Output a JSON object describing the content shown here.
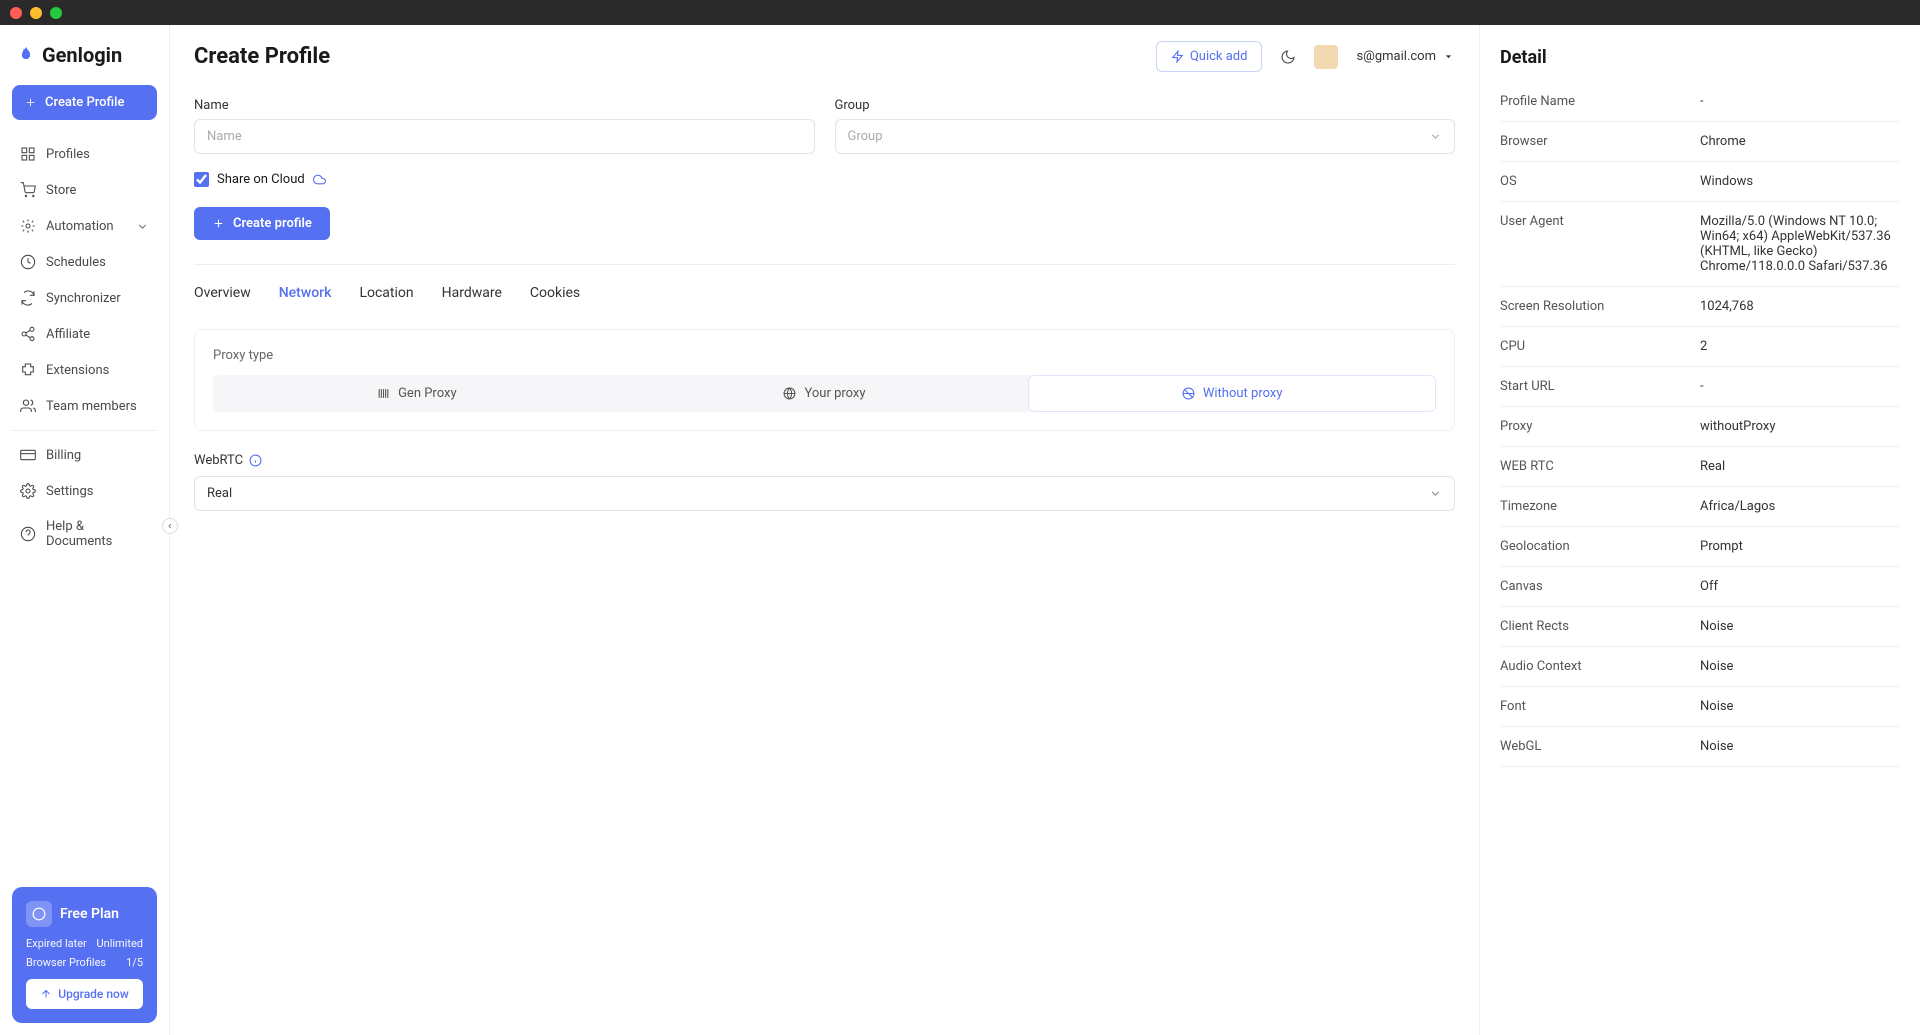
{
  "brand": "Genlogin",
  "sidebar": {
    "create_btn": "Create Profile",
    "items": [
      {
        "label": "Profiles"
      },
      {
        "label": "Store"
      },
      {
        "label": "Automation"
      },
      {
        "label": "Schedules"
      },
      {
        "label": "Synchronizer"
      },
      {
        "label": "Affiliate"
      },
      {
        "label": "Extensions"
      },
      {
        "label": "Team members"
      }
    ],
    "bottom_items": [
      {
        "label": "Billing"
      },
      {
        "label": "Settings"
      },
      {
        "label": "Help & Documents"
      }
    ]
  },
  "plan": {
    "title": "Free Plan",
    "rows": [
      {
        "k": "Expired later",
        "v": "Unlimited"
      },
      {
        "k": "Browser Profiles",
        "v": "1/5"
      }
    ],
    "upgrade": "Upgrade now"
  },
  "header": {
    "title": "Create Profile",
    "quick_add": "Quick add",
    "account": "s@gmail.com"
  },
  "form": {
    "name_label": "Name",
    "name_placeholder": "Name",
    "group_label": "Group",
    "group_placeholder": "Group",
    "share_label": "Share on Cloud",
    "submit": "Create profile",
    "tabs": [
      "Overview",
      "Network",
      "Location",
      "Hardware",
      "Cookies"
    ],
    "active_tab": "Network",
    "proxy_type_label": "Proxy type",
    "proxy_options": [
      "Gen Proxy",
      "Your proxy",
      "Without proxy"
    ],
    "proxy_active": "Without proxy",
    "webrtc_label": "WebRTC",
    "webrtc_value": "Real"
  },
  "detail": {
    "title": "Detail",
    "rows": [
      {
        "k": "Profile Name",
        "v": "-"
      },
      {
        "k": "Browser",
        "v": "Chrome"
      },
      {
        "k": "OS",
        "v": "Windows"
      },
      {
        "k": "User Agent",
        "v": "Mozilla/5.0 (Windows NT 10.0; Win64; x64) AppleWebKit/537.36 (KHTML, like Gecko) Chrome/118.0.0.0 Safari/537.36"
      },
      {
        "k": "Screen Resolution",
        "v": "1024,768"
      },
      {
        "k": "CPU",
        "v": "2"
      },
      {
        "k": "Start URL",
        "v": "-"
      },
      {
        "k": "Proxy",
        "v": "withoutProxy"
      },
      {
        "k": "WEB RTC",
        "v": "Real"
      },
      {
        "k": "Timezone",
        "v": "Africa/Lagos"
      },
      {
        "k": "Geolocation",
        "v": "Prompt"
      },
      {
        "k": "Canvas",
        "v": "Off"
      },
      {
        "k": "Client Rects",
        "v": "Noise"
      },
      {
        "k": "Audio Context",
        "v": "Noise"
      },
      {
        "k": "Font",
        "v": "Noise"
      },
      {
        "k": "WebGL",
        "v": "Noise"
      }
    ]
  }
}
